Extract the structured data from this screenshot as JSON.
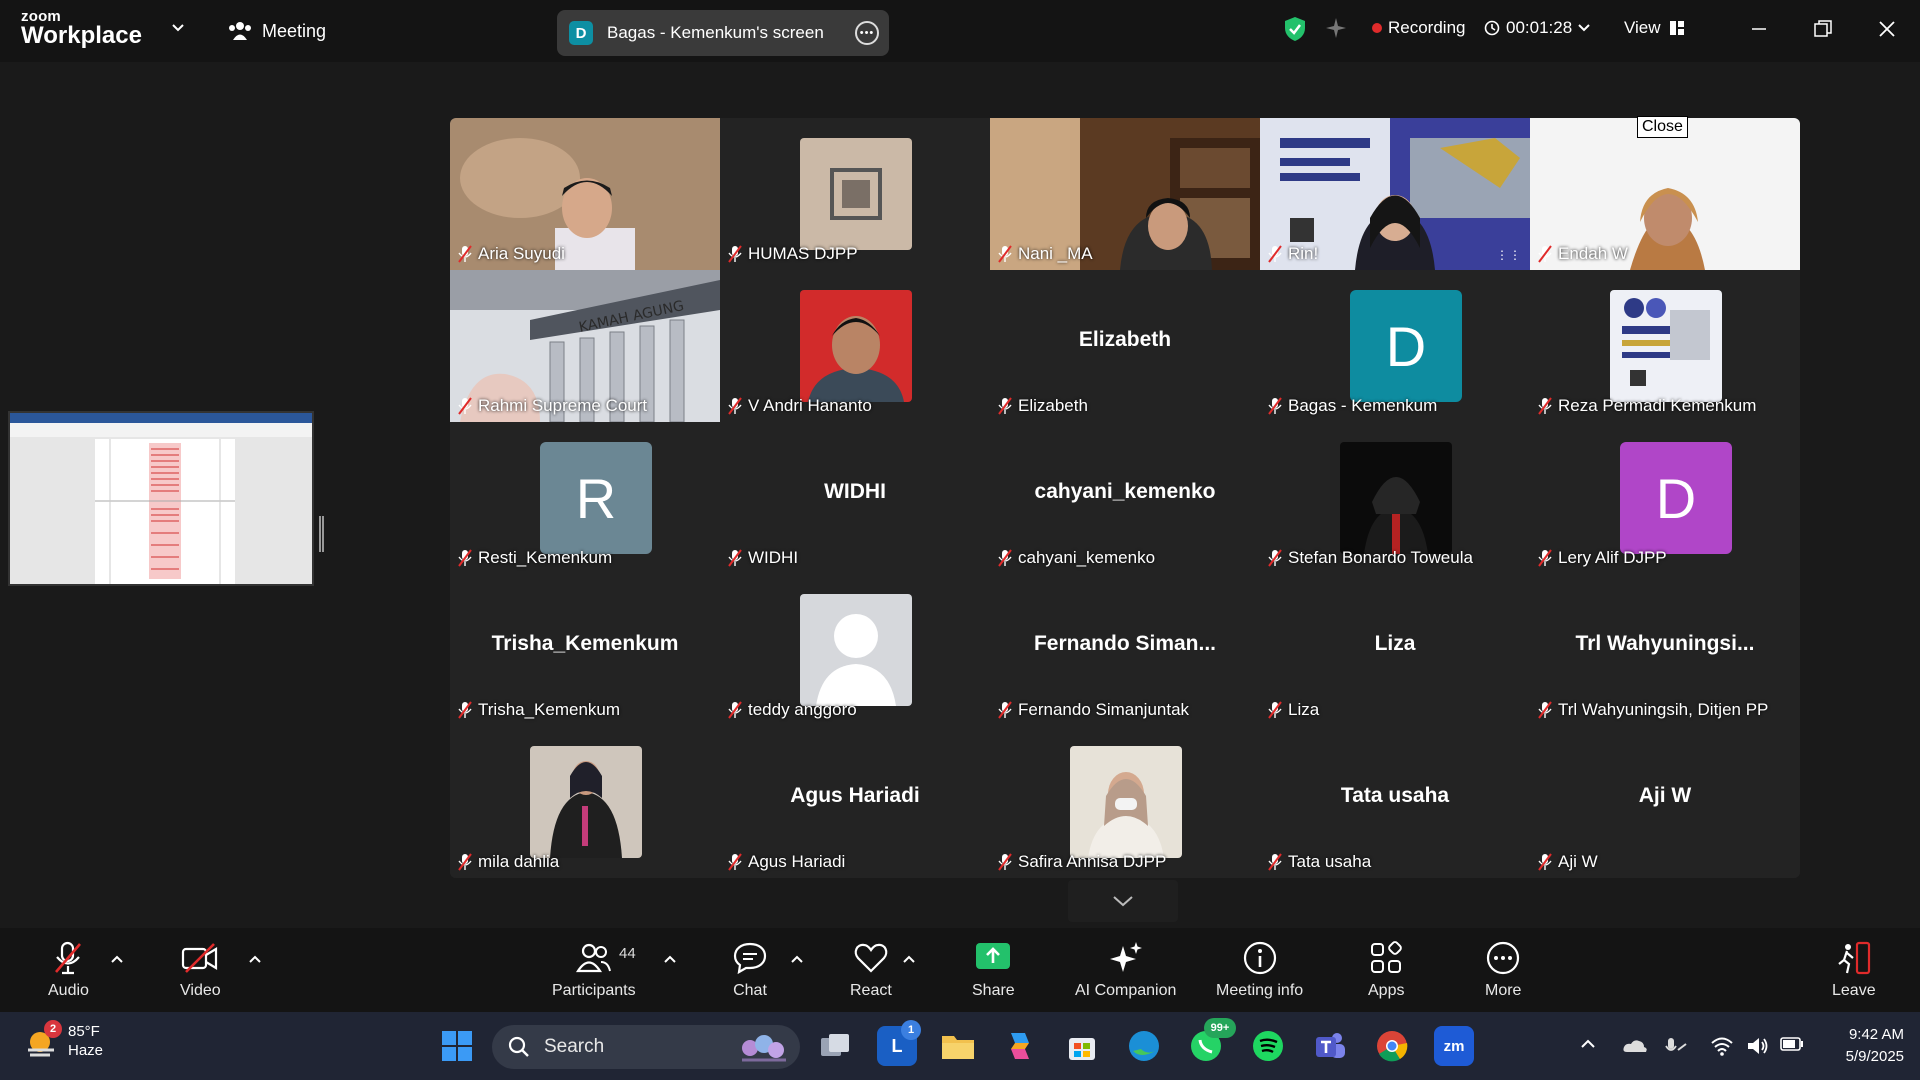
{
  "app": {
    "brand_small": "zoom",
    "brand_big": "Workplace",
    "meeting_tab": "Meeting"
  },
  "share": {
    "initial": "D",
    "label": "Bagas - Kemenkum's screen"
  },
  "status": {
    "recording": "Recording",
    "timer": "00:01:28",
    "view": "View"
  },
  "tooltip": "Close",
  "tiles": [
    {
      "display": "video",
      "label": "Aria Suyudi",
      "scene": "aria"
    },
    {
      "display": "photo",
      "label": "HUMAS DJPP",
      "scene": "humas"
    },
    {
      "display": "video",
      "label": "Nani _MA",
      "scene": "nani"
    },
    {
      "display": "video",
      "label": "Rin!",
      "scene": "rini",
      "active": true
    },
    {
      "display": "video",
      "label": "Endah W",
      "scene": "endah"
    },
    {
      "display": "video",
      "label": "Rahmi Supreme Court",
      "scene": "rahmi"
    },
    {
      "display": "photo",
      "label": "V Andri Hananto",
      "scene": "andri"
    },
    {
      "display": "name",
      "name": "Elizabeth",
      "label": "Elizabeth"
    },
    {
      "display": "avatar",
      "initial": "D",
      "color": "#0e8ca0",
      "label": "Bagas - Kemenkum"
    },
    {
      "display": "photo",
      "label": "Reza Permadi Kemenkum",
      "scene": "reza"
    },
    {
      "display": "avatar",
      "initial": "R",
      "color": "#6b8794",
      "label": "Resti_Kemenkum"
    },
    {
      "display": "name",
      "name": "WIDHI",
      "label": "WIDHI"
    },
    {
      "display": "name",
      "name": "cahyani_kemenko",
      "label": "cahyani_kemenko"
    },
    {
      "display": "photo",
      "label": "Stefan Bonardo Toweula",
      "scene": "stefan"
    },
    {
      "display": "avatar",
      "initial": "D",
      "color": "#b046c8",
      "label": "Lery Alif DJPP"
    },
    {
      "display": "name",
      "name": "Trisha_Kemenkum",
      "label": "Trisha_Kemenkum"
    },
    {
      "display": "photo",
      "label": "teddy anggoro",
      "scene": "teddy"
    },
    {
      "display": "name",
      "name": "Fernando Siman...",
      "label": "Fernando Simanjuntak"
    },
    {
      "display": "name",
      "name": "Liza",
      "label": "Liza"
    },
    {
      "display": "name",
      "name": "Trl Wahyuningsi...",
      "label": "Trl Wahyuningsih, Ditjen PP"
    },
    {
      "display": "photo",
      "label": "mila dahlia",
      "scene": "mila"
    },
    {
      "display": "name",
      "name": "Agus Hariadi",
      "label": "Agus Hariadi"
    },
    {
      "display": "photo",
      "label": "Safira Annisa DJPP",
      "scene": "safira"
    },
    {
      "display": "name",
      "name": "Tata usaha",
      "label": "Tata usaha"
    },
    {
      "display": "name",
      "name": "Aji W",
      "label": "Aji W"
    }
  ],
  "toolbar": {
    "audio": "Audio",
    "video": "Video",
    "participants": "Participants",
    "participants_count": "44",
    "chat": "Chat",
    "react": "React",
    "share": "Share",
    "ai": "AI Companion",
    "info": "Meeting info",
    "apps": "Apps",
    "more": "More",
    "leave": "Leave"
  },
  "taskbar": {
    "weather_badge": "2",
    "temp": "85°F",
    "condition": "Haze",
    "search_placeholder": "Search",
    "l_badge": "1",
    "whatsapp_badge": "99+",
    "time": "9:42 AM",
    "date": "5/9/2025"
  },
  "colors": {
    "accent_green": "#2ee07a",
    "record_red": "#e02b2b",
    "share_green": "#23c16b"
  }
}
